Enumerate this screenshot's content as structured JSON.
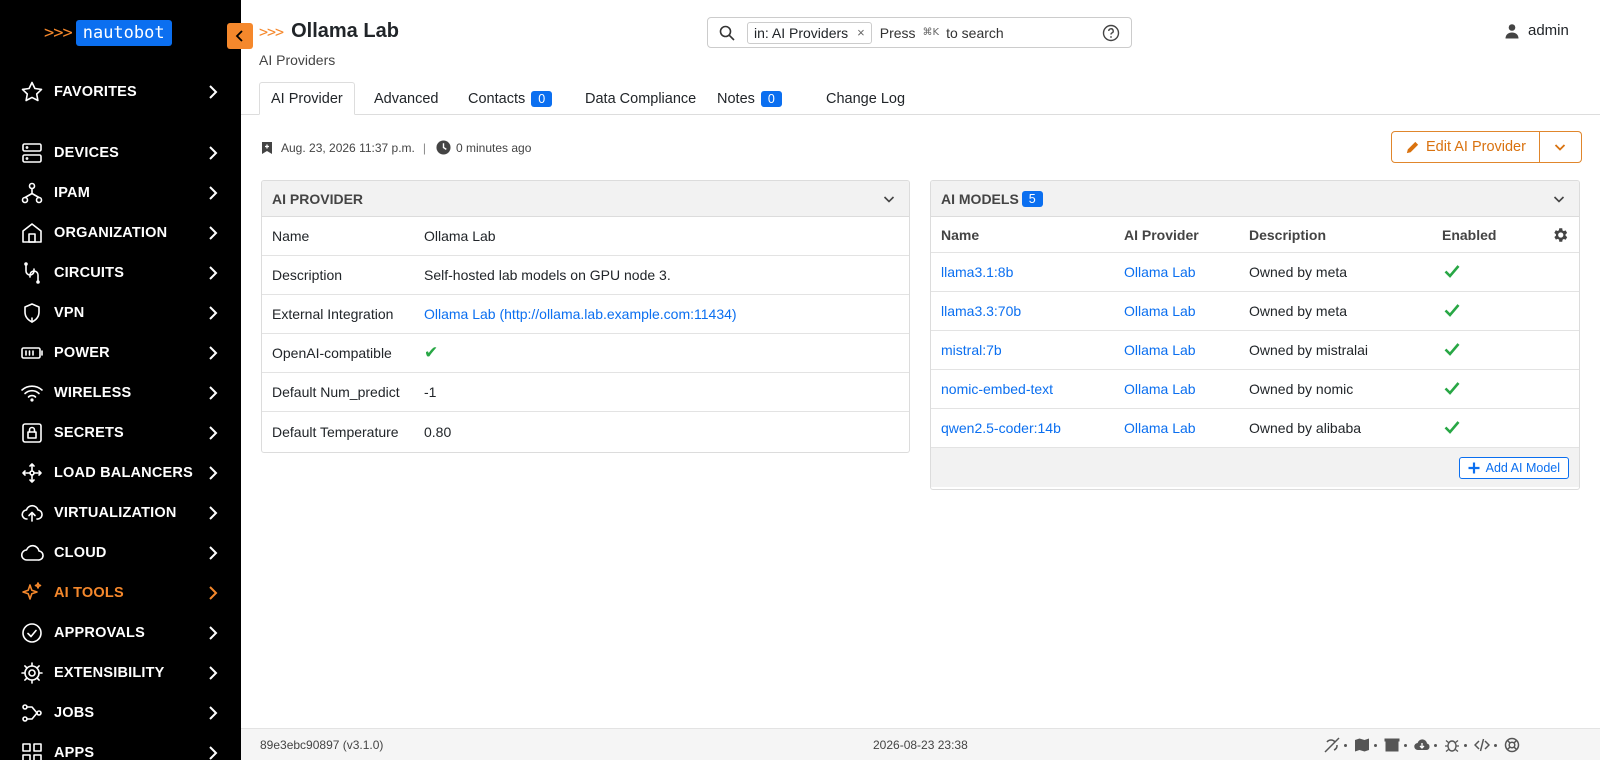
{
  "brand": {
    "arrows": ">>>",
    "name": "nautobot"
  },
  "sidebar": {
    "items": [
      {
        "label": "FAVORITES",
        "icon": "star-icon"
      },
      {
        "label": "DEVICES",
        "icon": "server-icon"
      },
      {
        "label": "IPAM",
        "icon": "network-icon"
      },
      {
        "label": "ORGANIZATION",
        "icon": "building-icon"
      },
      {
        "label": "CIRCUITS",
        "icon": "circuit-icon"
      },
      {
        "label": "VPN",
        "icon": "shield-icon"
      },
      {
        "label": "POWER",
        "icon": "battery-icon"
      },
      {
        "label": "WIRELESS",
        "icon": "wifi-icon"
      },
      {
        "label": "SECRETS",
        "icon": "lock-icon"
      },
      {
        "label": "LOAD BALANCERS",
        "icon": "load-balancer-icon"
      },
      {
        "label": "VIRTUALIZATION",
        "icon": "cloud-upload-icon"
      },
      {
        "label": "CLOUD",
        "icon": "cloud-icon"
      },
      {
        "label": "AI TOOLS",
        "icon": "sparkle-icon"
      },
      {
        "label": "APPROVALS",
        "icon": "check-circle-icon"
      },
      {
        "label": "EXTENSIBILITY",
        "icon": "gear-icon"
      },
      {
        "label": "JOBS",
        "icon": "jobs-icon"
      },
      {
        "label": "APPS",
        "icon": "apps-grid-icon"
      }
    ]
  },
  "header": {
    "arrows": ">>>",
    "title": "Ollama Lab",
    "breadcrumb": "AI Providers"
  },
  "search": {
    "chip": "in: AI Providers",
    "chip_close": "×",
    "press": "Press",
    "shortcut": "⌘K",
    "hint": "to search"
  },
  "user": {
    "name": "admin"
  },
  "tabs": {
    "ai_provider": "AI Provider",
    "advanced": "Advanced",
    "contacts": "Contacts",
    "contacts_count": "0",
    "data_compliance": "Data Compliance",
    "notes": "Notes",
    "notes_count": "0",
    "change_log": "Change Log"
  },
  "meta": {
    "created": "Aug. 23, 2026 11:37 p.m.",
    "separator": "|",
    "updated": "0 minutes ago"
  },
  "actions": {
    "edit": "Edit AI Provider"
  },
  "provider_panel": {
    "title": "AI PROVIDER",
    "rows": [
      {
        "key": "Name",
        "value": "Ollama Lab"
      },
      {
        "key": "Description",
        "value": "Self-hosted lab models on GPU node 3."
      },
      {
        "key": "External Integration",
        "value": "Ollama Lab (http://ollama.lab.example.com:11434)"
      },
      {
        "key": "OpenAI-compatible",
        "value": "✔"
      },
      {
        "key": "Default Num_predict",
        "value": "-1"
      },
      {
        "key": "Default Temperature",
        "value": "0.80"
      }
    ]
  },
  "models_panel": {
    "title": "AI MODELS",
    "count": "5",
    "columns": [
      "Name",
      "AI Provider",
      "Description",
      "Enabled"
    ],
    "rows": [
      {
        "name": "llama3.1:8b",
        "provider": "Ollama Lab",
        "description": "Owned by meta",
        "enabled": true
      },
      {
        "name": "llama3.3:70b",
        "provider": "Ollama Lab",
        "description": "Owned by meta",
        "enabled": true
      },
      {
        "name": "mistral:7b",
        "provider": "Ollama Lab",
        "description": "Owned by mistralai",
        "enabled": true
      },
      {
        "name": "nomic-embed-text",
        "provider": "Ollama Lab",
        "description": "Owned by nomic",
        "enabled": true
      },
      {
        "name": "qwen2.5-coder:14b",
        "provider": "Ollama Lab",
        "description": "Owned by alibaba",
        "enabled": true
      }
    ],
    "add_button": "Add AI Model"
  },
  "footer": {
    "version": "89e3ebc90897 (v3.1.0)",
    "timestamp": "2026-08-23 23:38"
  },
  "colors": {
    "brand_orange": "#f5882c",
    "link_blue": "#0b6ff0",
    "check_green": "#28a745",
    "sidebar_bg": "#000000"
  }
}
